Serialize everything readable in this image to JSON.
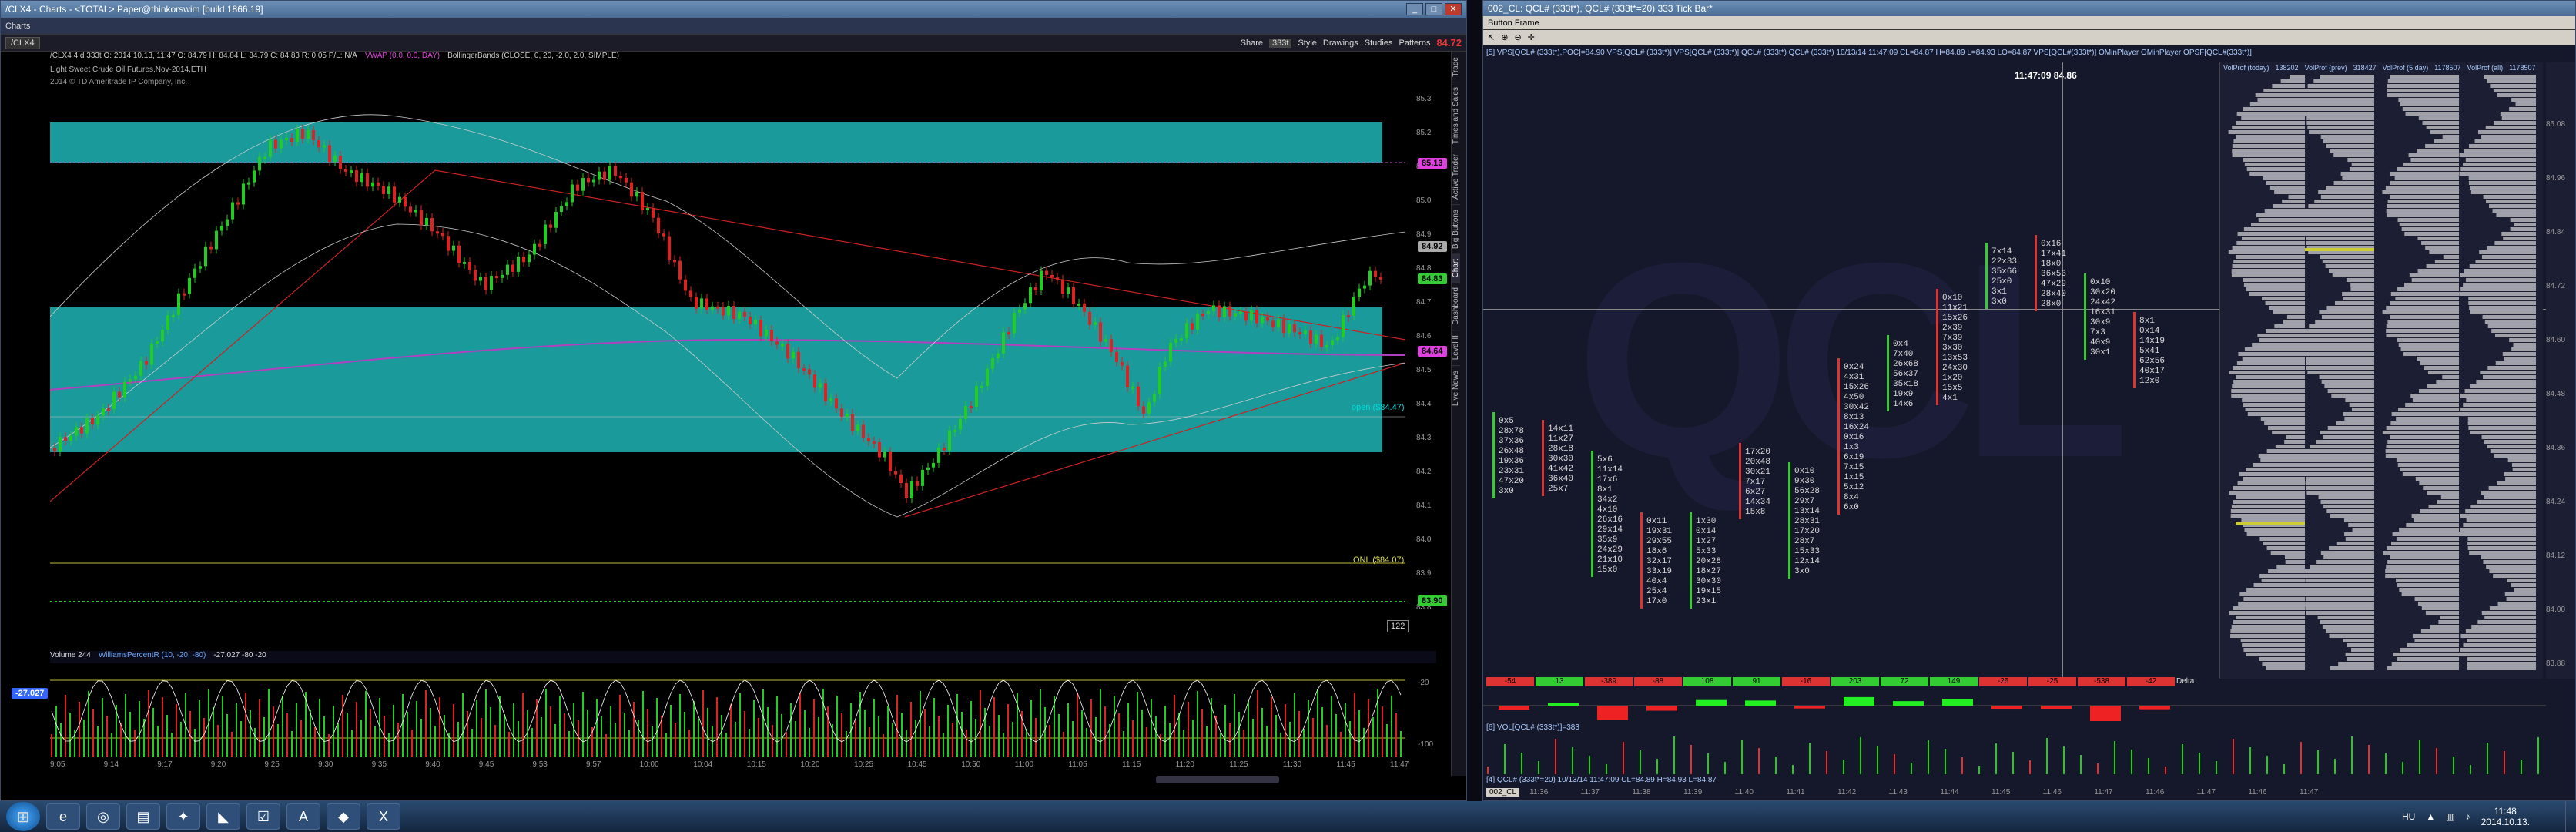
{
  "left_window": {
    "title": "/CLX4 - Charts - <TOTAL> Paper@thinkorswim [build 1866.19]",
    "menu_label": "Charts",
    "symbol": "/CLX4",
    "toolbar_items": [
      "Share",
      "333t",
      "Style",
      "Drawings",
      "Studies",
      "Patterns"
    ],
    "price_badge": "84.72",
    "header_line": "/CLX4 4 d 333t  O: 2014.10.13, 11:47  O: 84.79  H: 84.84  L: 84.79  C: 84.83  R: 0.05  P/L: N/A",
    "vwap_label": "VWAP (0.0, 0.0, DAY)",
    "bb_label": "BollingerBands (CLOSE, 0, 20, -2.0, 2.0, SIMPLE)",
    "instrument_desc": "Light Sweet Crude Oil Futures,Nov-2014,ETH",
    "copyright": "2014 © TD Ameritrade IP Company, Inc.",
    "price_labels": [
      "85.3",
      "85.2",
      "85.1",
      "85.0",
      "84.9",
      "84.8",
      "84.7",
      "84.6",
      "84.5",
      "84.4",
      "84.3",
      "84.2",
      "84.1",
      "84.0",
      "83.9",
      "83.8"
    ],
    "price_badges": [
      {
        "text": "85.13",
        "color": "#e040e0"
      },
      {
        "text": "84.92",
        "color": "#aaaaaa"
      },
      {
        "text": "84.83",
        "color": "#33cc33"
      },
      {
        "text": "84.64",
        "color": "#e040e0"
      },
      {
        "text": "83.90",
        "color": "#33cc33"
      }
    ],
    "open_label": "open ($84.47)",
    "onl_label": "ONL ($84.07)",
    "bar_count": "122",
    "volume_label": "Volume  244",
    "williams_label": "WilliamsPercentR (10, -20, -80)",
    "williams_values": "-27.027  -80  -20",
    "williams_badge": "-27.027",
    "williams_scale": [
      "-20",
      "-100"
    ],
    "time_labels": [
      "9:05",
      "9:14",
      "9:17",
      "9:20",
      "9:25",
      "9:30",
      "9:35",
      "9:40",
      "9:45",
      "9:53",
      "9:57",
      "10:00",
      "10:04",
      "10:15",
      "10:20",
      "10:25",
      "10:45",
      "10:50",
      "11:00",
      "11:05",
      "11:15",
      "11:20",
      "11:25",
      "11:30",
      "11:45",
      "11:47"
    ],
    "side_tabs": [
      "Trade",
      "Times and Sales",
      "Active Trader",
      "Big Buttons",
      "Chart",
      "Dashboard",
      "Level II",
      "Live News"
    ]
  },
  "right_window": {
    "title": "002_CL: QCL# (333t*), QCL# (333t*=20) 333 Tick Bar*",
    "button_frame": "Button Frame",
    "indicator_line": "[5] VPS[QCL# (333t*),POC]=84.90  VPS[QCL# (333t*)]  VPS[QCL# (333t*)]  QCL# (333t*)  QCL# (333t*) 10/13/14 11:47:09 CL=84.87 H=84.89 L=84.93 LO=84.87  VPS[QCL#(333t*)]  OMinPlayer  OMinPlayer  OPSF[QCL#(333t*)]",
    "crosshair_time": "11:47:09  84.86",
    "vp_headers": [
      {
        "label": "VolProf (today)",
        "value": "138202"
      },
      {
        "label": "VolProf (prev)",
        "value": "318427"
      },
      {
        "label": "VolProf (5 day)",
        "value": "1178507"
      },
      {
        "label": "VolProf (all)",
        "value": "1178507"
      }
    ],
    "price_scale": [
      "85.08",
      "84.96",
      "84.84",
      "84.72",
      "84.60",
      "84.48",
      "84.36",
      "84.24",
      "84.12",
      "84.00",
      "83.88"
    ],
    "delta_label": "Delta",
    "delta_values": [
      "-54",
      "13",
      "-389",
      "-88",
      "108",
      "91",
      "-16",
      "203",
      "72",
      "149",
      "-26",
      "-25",
      "-538",
      "-42"
    ],
    "vol_line": "[6] VOL[QCL# (333t*)]=383",
    "bottom_line": "[4] QCL# (333t*=20) 10/13/14 11:47:09 CL=84.89 H=84.93 L=84.87",
    "bottom_tab": "002_CL",
    "time_axis": [
      "11:36",
      "11:37",
      "11:38",
      "11:39",
      "11:40",
      "11:41",
      "11:42",
      "11:43",
      "11:44",
      "11:45",
      "11:46",
      "11:47",
      "11:46",
      "11:47",
      "11:46",
      "11:47"
    ],
    "clusters": [
      "0x5\n28x78\n37x36\n26x48\n19x36\n23x31\n47x20\n3x0",
      "14x11\n11x27\n28x18\n30x30\n41x42\n36x40\n25x7",
      "5x6\n11x14\n17x6\n8x1\n34x2\n4x10\n26x16\n29x14\n35x9\n24x29\n21x10\n15x0",
      "0x11\n19x31\n29x55\n18x6\n32x17\n33x19\n40x4\n25x4\n17x0",
      "1x30\n0x14\n1x27\n5x33\n20x28\n18x27\n30x30\n19x15\n23x1",
      "17x20\n20x48\n30x21\n7x17\n6x27\n14x34\n15x8",
      "0x10\n9x30\n56x28\n29x7\n13x14\n28x31\n17x20\n28x7\n15x33\n12x14\n3x0",
      "0x24\n4x31\n15x26\n4x50\n30x42\n8x13\n16x24\n0x16\n1x3\n6x19\n7x15\n1x15\n5x12\n8x4\n6x0",
      "0x4\n7x40\n26x68\n56x37\n35x18\n19x9\n14x6",
      "0x10\n11x21\n15x26\n2x39\n7x39\n3x30\n13x53\n24x30\n1x20\n15x5\n4x1",
      "7x14\n22x33\n35x66\n25x0\n3x1\n3x0",
      "0x16\n17x41\n18x0\n36x53\n47x29\n28x40\n28x0",
      "0x10\n30x20\n24x42\n16x31\n30x9\n7x3\n40x9\n30x1",
      "8x1\n0x14\n14x19\n5x41\n62x56\n40x17\n12x0"
    ]
  },
  "taskbar": {
    "lang": "HU",
    "time": "11:48",
    "date": "2014.10.13."
  },
  "colors": {
    "teal_zone": "#1a9a9a",
    "up_candle": "#22cc22",
    "down_candle": "#dd2222",
    "magenta": "#e040e0"
  }
}
